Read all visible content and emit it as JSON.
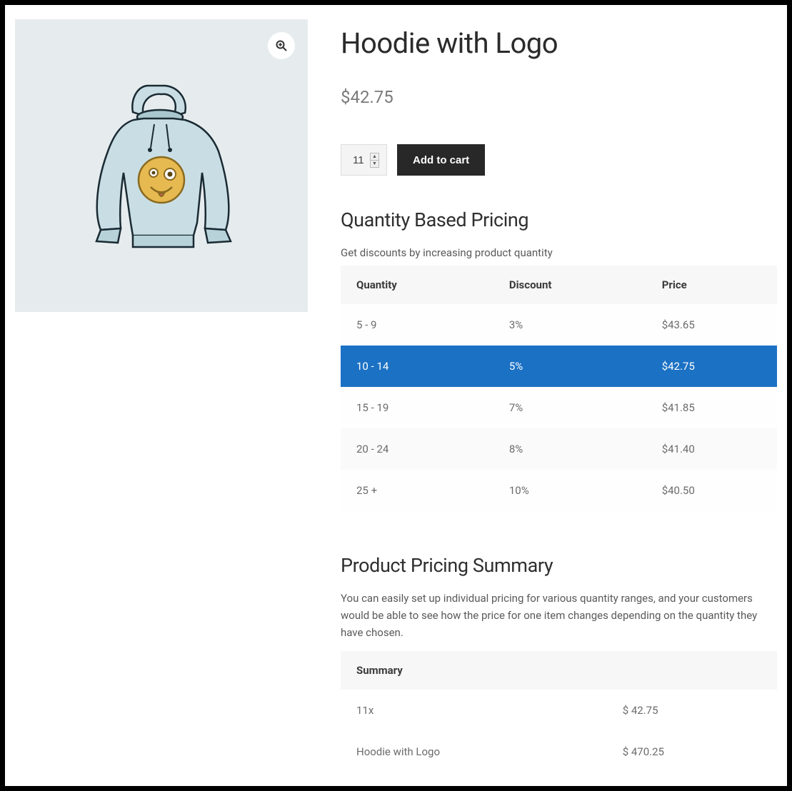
{
  "product": {
    "title": "Hoodie with Logo",
    "price": "$42.75",
    "quantity_value": "11",
    "add_to_cart_label": "Add to cart"
  },
  "pricing_section": {
    "heading": "Quantity Based Pricing",
    "subtext": "Get discounts by increasing product quantity",
    "columns": {
      "qty": "Quantity",
      "discount": "Discount",
      "price": "Price"
    },
    "rows": [
      {
        "qty": "5 - 9",
        "discount": "3%",
        "price": "$43.65",
        "active": false
      },
      {
        "qty": "10 - 14",
        "discount": "5%",
        "price": "$42.75",
        "active": true
      },
      {
        "qty": "15 - 19",
        "discount": "7%",
        "price": "$41.85",
        "active": false
      },
      {
        "qty": "20 - 24",
        "discount": "8%",
        "price": "$41.40",
        "active": false
      },
      {
        "qty": "25 +",
        "discount": "10%",
        "price": "$40.50",
        "active": false
      }
    ]
  },
  "summary_section": {
    "heading": "Product Pricing Summary",
    "subtext": "You can easily set up individual pricing for various quantity ranges, and your customers would be able to see how the price for one item changes depending on the quantity they have chosen.",
    "column": "Summary",
    "rows": [
      {
        "label": "11x",
        "value": "$ 42.75"
      },
      {
        "label": "Hoodie with Logo",
        "value": "$ 470.25"
      }
    ]
  }
}
